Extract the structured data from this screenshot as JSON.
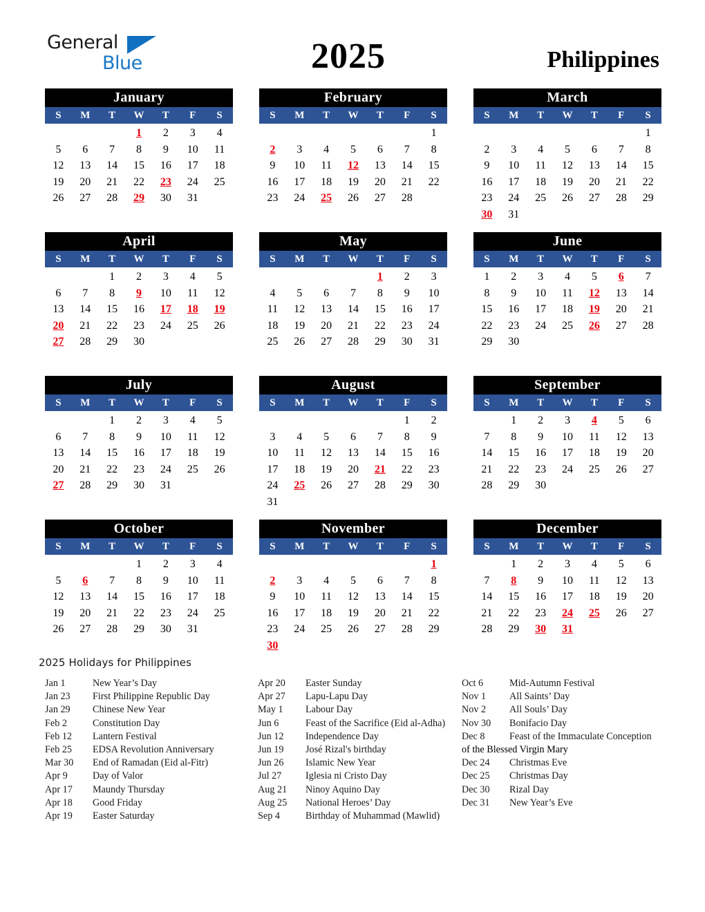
{
  "logo": {
    "word_top": "General",
    "word_bottom": "Blue",
    "triangle_color": "#1070c0",
    "blue_text_color": "#1878c8"
  },
  "header": {
    "year": "2025",
    "country": "Philippines"
  },
  "colors": {
    "month_header_bg": "#000000",
    "weekday_header_bg": "#2e5496",
    "holiday_text": "#e8000d",
    "text": "#000000"
  },
  "weekday_labels": [
    "S",
    "M",
    "T",
    "W",
    "T",
    "F",
    "S"
  ],
  "months": [
    {
      "name": "January",
      "lead_blank": 3,
      "days": 31,
      "holidays": [
        1,
        23,
        29
      ]
    },
    {
      "name": "February",
      "lead_blank": 6,
      "days": 28,
      "holidays": [
        2,
        12,
        25
      ]
    },
    {
      "name": "March",
      "lead_blank": 6,
      "days": 31,
      "holidays": [
        30
      ]
    },
    {
      "name": "April",
      "lead_blank": 2,
      "days": 30,
      "holidays": [
        9,
        17,
        18,
        19,
        20,
        27
      ]
    },
    {
      "name": "May",
      "lead_blank": 4,
      "days": 31,
      "holidays": [
        1
      ]
    },
    {
      "name": "June",
      "lead_blank": 0,
      "days": 30,
      "holidays": [
        6,
        12,
        19,
        26
      ]
    },
    {
      "name": "July",
      "lead_blank": 2,
      "days": 31,
      "holidays": [
        27
      ]
    },
    {
      "name": "August",
      "lead_blank": 5,
      "days": 31,
      "holidays": [
        21,
        25
      ]
    },
    {
      "name": "September",
      "lead_blank": 1,
      "days": 30,
      "holidays": [
        4
      ]
    },
    {
      "name": "October",
      "lead_blank": 3,
      "days": 31,
      "holidays": [
        6
      ]
    },
    {
      "name": "November",
      "lead_blank": 6,
      "days": 30,
      "holidays": [
        1,
        2,
        30
      ]
    },
    {
      "name": "December",
      "lead_blank": 1,
      "days": 31,
      "holidays": [
        8,
        24,
        25,
        30,
        31
      ]
    }
  ],
  "holidays_section": {
    "title": "2025 Holidays for Philippines",
    "columns": [
      [
        {
          "date": "Jan 1",
          "name": "New Year’s Day"
        },
        {
          "date": "Jan 23",
          "name": "First Philippine Republic Day"
        },
        {
          "date": "Jan 29",
          "name": "Chinese New Year"
        },
        {
          "date": "Feb 2",
          "name": "Constitution Day"
        },
        {
          "date": "Feb 12",
          "name": "Lantern Festival"
        },
        {
          "date": "Feb 25",
          "name": "EDSA Revolution Anniversary"
        },
        {
          "date": "Mar 30",
          "name": "End of Ramadan (Eid al-Fitr)"
        },
        {
          "date": "Apr 9",
          "name": "Day of Valor"
        },
        {
          "date": "Apr 17",
          "name": "Maundy Thursday"
        },
        {
          "date": "Apr 18",
          "name": "Good Friday"
        },
        {
          "date": "Apr 19",
          "name": "Easter Saturday"
        }
      ],
      [
        {
          "date": "Apr 20",
          "name": "Easter Sunday"
        },
        {
          "date": "Apr 27",
          "name": "Lapu-Lapu Day"
        },
        {
          "date": "May 1",
          "name": "Labour Day"
        },
        {
          "date": "Jun 6",
          "name": "Feast of the Sacrifice (Eid al-Adha)"
        },
        {
          "date": "Jun 12",
          "name": "Independence Day"
        },
        {
          "date": "Jun 19",
          "name": "José Rizal's birthday"
        },
        {
          "date": "Jun 26",
          "name": "Islamic New Year"
        },
        {
          "date": "Jul 27",
          "name": "Iglesia ni Cristo Day"
        },
        {
          "date": "Aug 21",
          "name": "Ninoy Aquino Day"
        },
        {
          "date": "Aug 25",
          "name": "National Heroes’ Day"
        },
        {
          "date": "Sep 4",
          "name": "Birthday of Muhammad (Mawlid)"
        }
      ],
      [
        {
          "date": "Oct 6",
          "name": "Mid-Autumn Festival"
        },
        {
          "date": "Nov 1",
          "name": "All Saints’ Day"
        },
        {
          "date": "Nov 2",
          "name": "All Souls’ Day"
        },
        {
          "date": "Nov 30",
          "name": "Bonifacio Day"
        },
        {
          "date": "Dec 8",
          "name": "Feast of the Immaculate Conception",
          "continuation": "of the Blessed Virgin Mary"
        },
        {
          "date": "Dec 24",
          "name": "Christmas Eve"
        },
        {
          "date": "Dec 25",
          "name": "Christmas Day"
        },
        {
          "date": "Dec 30",
          "name": "Rizal Day"
        },
        {
          "date": "Dec 31",
          "name": "New Year’s Eve"
        }
      ]
    ]
  }
}
